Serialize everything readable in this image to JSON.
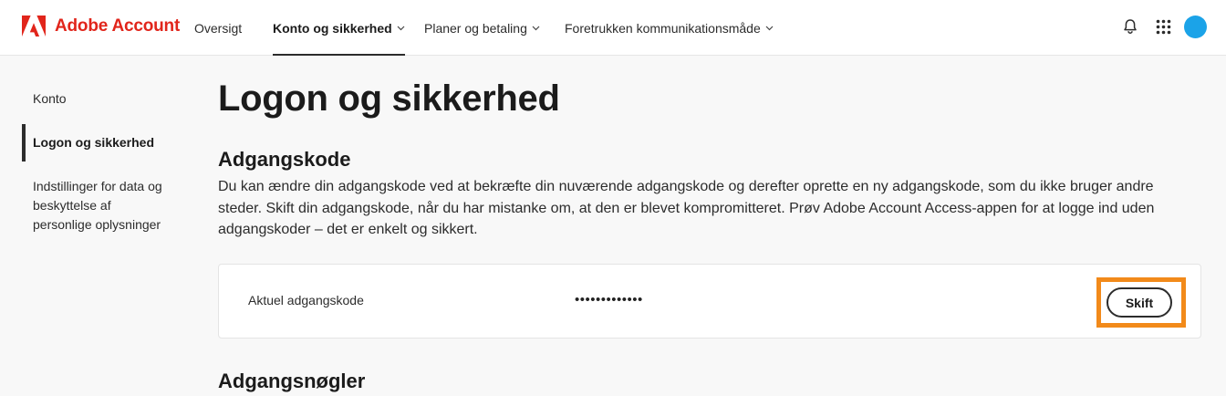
{
  "brand": {
    "name": "Adobe Account",
    "color": "#e1251b"
  },
  "nav": {
    "items": [
      {
        "label": "Oversigt",
        "has_dropdown": false
      },
      {
        "label": "Konto og sikkerhed",
        "has_dropdown": true,
        "active": true
      },
      {
        "label": "Planer og betaling",
        "has_dropdown": true
      },
      {
        "label": "Foretrukken kommunikationsmåde",
        "has_dropdown": true
      }
    ],
    "icons": [
      "bell-icon",
      "apps-grid-icon"
    ]
  },
  "sidebar": {
    "items": [
      {
        "label": "Konto"
      },
      {
        "label": "Logon og sikkerhed",
        "active": true
      },
      {
        "label": "Indstillinger for data og beskyttelse af personlige oplysninger"
      }
    ]
  },
  "main": {
    "title": "Logon og sikkerhed",
    "password": {
      "heading": "Adgangskode",
      "description": "Du kan ændre din adgangskode ved at bekræfte din nuværende adgangskode og derefter oprette en ny adgangskode, som du ikke bruger andre steder. Skift din adgangskode, når du har mistanke om, at den er blevet kompromitteret. Prøv Adobe Account Access-appen for at logge ind uden adgangskoder – det er enkelt og sikkert.",
      "current_label": "Aktuel adgangskode",
      "current_value": "•••••••••••••",
      "change_label": "Skift"
    },
    "passkeys": {
      "heading": "Adgangsnøgler"
    }
  },
  "colors": {
    "accent": "#f28a1a",
    "avatar": "#1ba3e8"
  }
}
